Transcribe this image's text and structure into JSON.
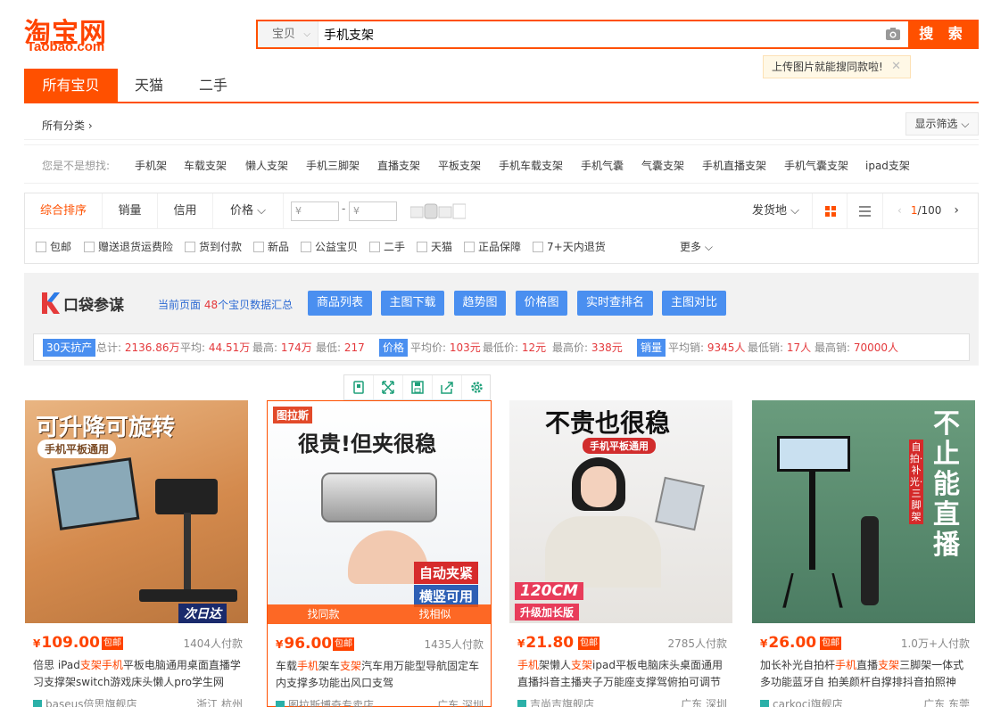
{
  "header": {
    "logo_cn": "淘宝网",
    "logo_en": "Taobao.com",
    "search_type": "宝贝",
    "search_query": "手机支架",
    "search_button": "搜 索",
    "tip": "上传图片就能搜同款啦!"
  },
  "tabs": [
    "所有宝贝",
    "天猫",
    "二手"
  ],
  "category": {
    "all": "所有分类",
    "filter": "显示筛选"
  },
  "suggest": {
    "label": "您是不是想找:",
    "items": [
      "手机架",
      "车载支架",
      "懒人支架",
      "手机三脚架",
      "直播支架",
      "平板支架",
      "手机车载支架",
      "手机气囊",
      "气囊支架",
      "手机直播支架",
      "手机气囊支架",
      "ipad支架"
    ]
  },
  "sort": {
    "items": [
      "综合排序",
      "销量",
      "信用",
      "价格"
    ],
    "price_placeholder": "¥",
    "ship": "发货地",
    "page": "1",
    "pages": "/100"
  },
  "checks": [
    "包邮",
    "赠送退货运费险",
    "货到付款",
    "新品",
    "公益宝贝",
    "二手",
    "天猫",
    "正品保障",
    "7+天内退货"
  ],
  "more": "更多",
  "plugin": {
    "name": "口袋参谋",
    "current_prefix": "当前页面",
    "current_count": "48",
    "current_suffix": "个宝贝数据汇总",
    "buttons": [
      "商品列表",
      "主图下载",
      "趋势图",
      "价格图",
      "实时查排名",
      "主图对比"
    ],
    "stats": {
      "tag1": "30天抗产",
      "total_label": "总计:",
      "total": "2136.86万",
      "avg_label": "平均:",
      "avg": "44.51万",
      "max_label": "最高:",
      "max": "174万",
      "min_label": "最低:",
      "min": "217",
      "tag2": "价格",
      "pavg_label": "平均价:",
      "pavg": "103元",
      "pmin_label": "最低价:",
      "pmin": "12元",
      "pmax_label": "最高价:",
      "pmax": "338元",
      "tag3": "销量",
      "savg_label": "平均销:",
      "savg": "9345人",
      "smin_label": "最低销:",
      "smin": "17人",
      "smax_label": "最高销:",
      "smax": "70000人"
    }
  },
  "products": [
    {
      "price": "109.00",
      "badge": "包邮",
      "sales": "1404人付款",
      "title_pre": "倍思 iPad",
      "title_hl": "支架手机",
      "title_post": "平板电脑通用桌面直播学习支撑架switch游戏床头懒人pro学生网",
      "shop": "baseus倍思旗舰店",
      "loc": "浙江 杭州",
      "img_text1": "可升降可旋转",
      "img_text2": "手机平板通用",
      "img_text3": "次日达"
    },
    {
      "price": "96.00",
      "badge": "包邮",
      "sales": "1435人付款",
      "title_pre": "车载",
      "title_hl": "手机",
      "title_mid": "架车",
      "title_hl2": "支架",
      "title_post": "汽车用万能型导航固定车内支撑多功能出风口支驾",
      "shop": "图拉斯博奇专卖店",
      "loc": "广东 深圳",
      "img_text1": "很贵!但夹很稳",
      "img_text2": "图拉斯",
      "img_text3": "自动夹紧",
      "img_text4": "横竖可用",
      "find1": "找同款",
      "find2": "找相似"
    },
    {
      "price": "21.80",
      "badge": "包邮",
      "sales": "2785人付款",
      "title_hl": "手机",
      "title_mid": "架懒人",
      "title_hl2": "支架",
      "title_post": "ipad平板电脑床头桌面通用直播抖音主播夹子万能座支撑驾俯拍可调节",
      "shop": "吉尚吉旗舰店",
      "loc": "广东 深圳",
      "img_text1": "不贵也很稳",
      "img_text2": "手机平板通用",
      "img_text3": "120CM",
      "img_text4": "升级加长版"
    },
    {
      "price": "26.00",
      "badge": "包邮",
      "sales": "1.0万+人付款",
      "title_pre": "加长补光自拍杆",
      "title_hl": "手机",
      "title_mid": "直播",
      "title_hl2": "支架",
      "title_post": "三脚架一体式多功能蓝牙自 拍美颜杆自撑排抖音拍照神",
      "shop": "carkoci旗舰店",
      "loc": "广东 东莞",
      "img_text1": "不止能直播",
      "img_text2": "自拍·补光·三脚架"
    }
  ]
}
